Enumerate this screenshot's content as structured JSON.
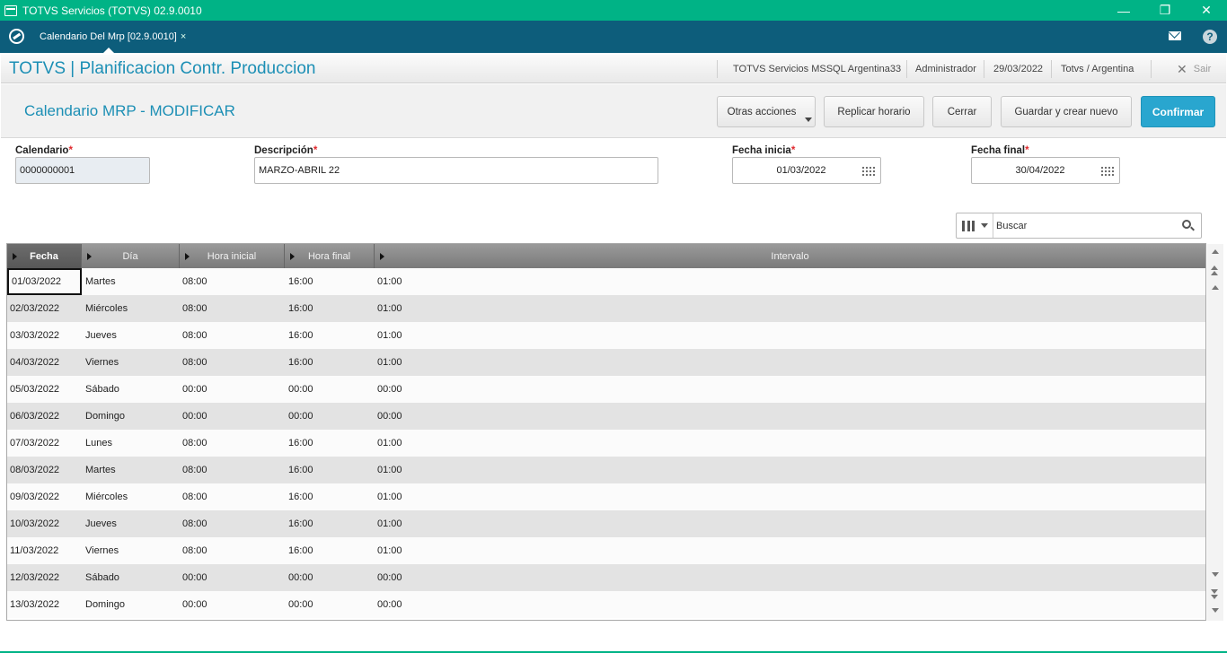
{
  "window": {
    "title": "TOTVS Servicios (TOTVS) 02.9.0010",
    "minimize": "—",
    "restore": "❐",
    "close": "✕"
  },
  "tabbar": {
    "tab_label": "Calendario Del Mrp [02.9.0010]",
    "tab_close": "×",
    "help": "?"
  },
  "header": {
    "app_title": "TOTVS | Planificacion Contr. Produccion",
    "environment": "TOTVS Servicios MSSQL Argentina33",
    "user": "Administrador",
    "date": "29/03/2022",
    "company": "Totvs / Argentina",
    "exit_label": "Sair"
  },
  "form": {
    "title": "Calendario MRP - MODIFICAR",
    "buttons": {
      "more_actions": "Otras acciones",
      "replicate": "Replicar horario",
      "close": "Cerrar",
      "save_new": "Guardar y crear nuevo",
      "confirm": "Confirmar"
    },
    "fields": {
      "calendar": {
        "label": "Calendario",
        "value": "0000000001"
      },
      "description": {
        "label": "Descripción",
        "value": "MARZO-ABRIL 22"
      },
      "start_date": {
        "label": "Fecha inicia",
        "value": "01/03/2022"
      },
      "end_date": {
        "label": "Fecha final",
        "value": "30/04/2022"
      },
      "required_mark": "*"
    }
  },
  "search": {
    "placeholder": "Buscar"
  },
  "grid": {
    "columns": [
      "Fecha",
      "Día",
      "Hora inicial",
      "Hora final",
      "Intervalo"
    ],
    "rows": [
      [
        "01/03/2022",
        "Martes",
        "08:00",
        "16:00",
        "01:00"
      ],
      [
        "02/03/2022",
        "Miércoles",
        "08:00",
        "16:00",
        "01:00"
      ],
      [
        "03/03/2022",
        "Jueves",
        "08:00",
        "16:00",
        "01:00"
      ],
      [
        "04/03/2022",
        "Viernes",
        "08:00",
        "16:00",
        "01:00"
      ],
      [
        "05/03/2022",
        "Sábado",
        "00:00",
        "00:00",
        "00:00"
      ],
      [
        "06/03/2022",
        "Domingo",
        "00:00",
        "00:00",
        "00:00"
      ],
      [
        "07/03/2022",
        "Lunes",
        "08:00",
        "16:00",
        "01:00"
      ],
      [
        "08/03/2022",
        "Martes",
        "08:00",
        "16:00",
        "01:00"
      ],
      [
        "09/03/2022",
        "Miércoles",
        "08:00",
        "16:00",
        "01:00"
      ],
      [
        "10/03/2022",
        "Jueves",
        "08:00",
        "16:00",
        "01:00"
      ],
      [
        "11/03/2022",
        "Viernes",
        "08:00",
        "16:00",
        "01:00"
      ],
      [
        "12/03/2022",
        "Sábado",
        "00:00",
        "00:00",
        "00:00"
      ],
      [
        "13/03/2022",
        "Domingo",
        "00:00",
        "00:00",
        "00:00"
      ]
    ]
  },
  "colors": {
    "titlebar": "#00b386",
    "tabbar": "#0d5d7b",
    "accent": "#1c8fb5",
    "primary_button": "#29a6cf",
    "required": "#e0282d"
  }
}
